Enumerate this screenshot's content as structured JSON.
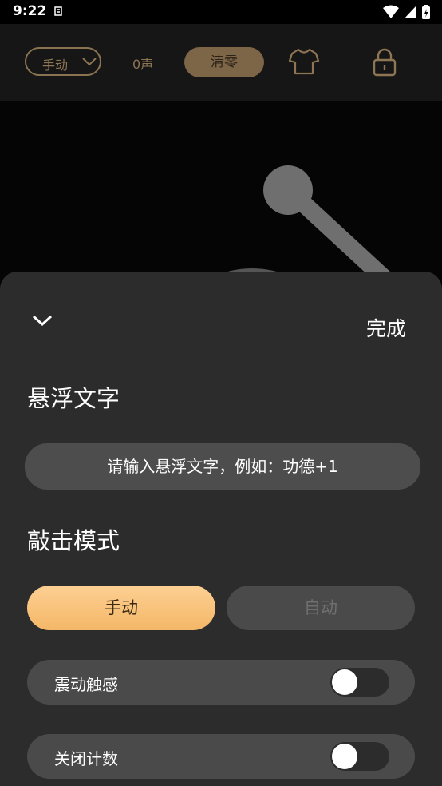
{
  "status_bar": {
    "time": "9:22"
  },
  "toolbar": {
    "mode_selected": "手动",
    "count_text": "0声",
    "clear_label": "清零",
    "icons": [
      "chevron-down-icon",
      "shirt-icon",
      "lock-icon"
    ]
  },
  "sheet": {
    "done_label": "完成",
    "floating_text": {
      "title": "悬浮文字",
      "placeholder": "请输入悬浮文字，例如：功德+1",
      "value": ""
    },
    "tap_mode": {
      "title": "敲击模式",
      "options": [
        "手动",
        "自动"
      ],
      "selected": "手动"
    },
    "settings": [
      {
        "label": "震动触感",
        "enabled": false
      },
      {
        "label": "关闭计数",
        "enabled": false
      }
    ]
  },
  "colors": {
    "accent_gold": "#7d6547",
    "selected_gradient_top": "#fdd093",
    "selected_gradient_bottom": "#f4b767",
    "sheet_bg": "#2c2c2c"
  }
}
